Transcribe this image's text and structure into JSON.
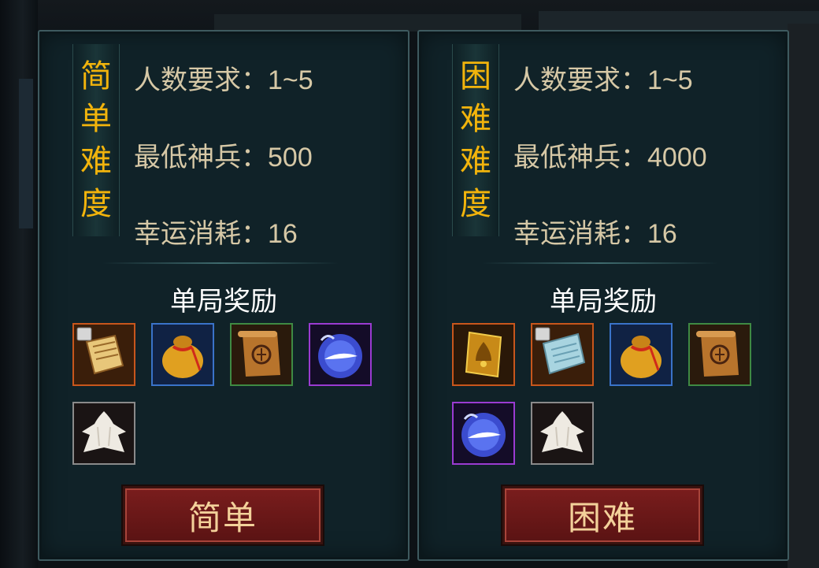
{
  "panels": [
    {
      "difficulty_vertical": [
        "简",
        "单",
        "难",
        "度"
      ],
      "player_req": "人数要求：1~5",
      "min_weapon": "最低神兵：500",
      "luck_cost": "幸运消耗：16",
      "reward_title": "单局奖励",
      "rewards": [
        {
          "icon": "locked-scroll-icon",
          "border": "orange"
        },
        {
          "icon": "coin-bag-icon",
          "border": "blue"
        },
        {
          "icon": "rune-scroll-icon",
          "border": "green"
        },
        {
          "icon": "spirit-orb-icon",
          "border": "purple"
        },
        {
          "icon": "white-fur-icon",
          "border": "gray"
        }
      ],
      "button_label": "简单"
    },
    {
      "difficulty_vertical": [
        "困",
        "难",
        "难",
        "度"
      ],
      "player_req": "人数要求：1~5",
      "min_weapon": "最低神兵：4000",
      "luck_cost": "幸运消耗：16",
      "reward_title": "单局奖励",
      "rewards": [
        {
          "icon": "golden-bell-card-icon",
          "border": "orange"
        },
        {
          "icon": "locked-ice-scroll-icon",
          "border": "orange"
        },
        {
          "icon": "coin-bag-icon",
          "border": "blue"
        },
        {
          "icon": "rune-scroll-icon",
          "border": "green"
        },
        {
          "icon": "spirit-orb-icon",
          "border": "purple"
        },
        {
          "icon": "white-fur-icon",
          "border": "gray"
        }
      ],
      "button_label": "困难"
    }
  ],
  "colors": {
    "panel_bg": "#102228",
    "difficulty_text": "#f2b40c",
    "stat_text": "#d6c8a6",
    "button_bg": "#6a1818",
    "button_text": "#f3d19a"
  }
}
